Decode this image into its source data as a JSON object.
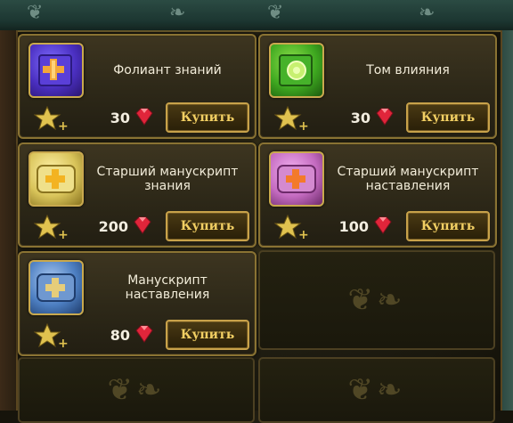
{
  "shop": {
    "currency_icon": "ruby-gem-icon",
    "items": [
      {
        "title": "Фолиант знаний",
        "price": "30",
        "buy_label": "Купить",
        "icon": "purple-tome-icon",
        "color": "#5b3fd0"
      },
      {
        "title": "Том влияния",
        "price": "30",
        "buy_label": "Купить",
        "icon": "green-tome-icon",
        "color": "#3ea820"
      },
      {
        "title": "Старший манускрипт знания",
        "price": "200",
        "buy_label": "Купить",
        "icon": "golden-scroll-icon",
        "color": "#d9c45a"
      },
      {
        "title": "Старший манускрипт наставления",
        "price": "100",
        "buy_label": "Купить",
        "icon": "pink-scroll-icon",
        "color": "#c46bc0"
      },
      {
        "title": "Манускрипт наставления",
        "price": "80",
        "buy_label": "Купить",
        "icon": "blue-scroll-icon",
        "color": "#4d7fc2"
      }
    ]
  }
}
